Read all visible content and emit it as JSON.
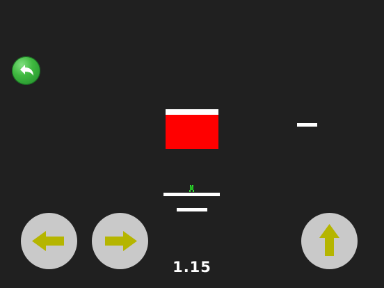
{
  "hud": {
    "timer": "1.15"
  },
  "controls": {
    "back": {
      "icon": "back-arrow-icon"
    },
    "left": {
      "icon": "arrow-left-icon"
    },
    "right": {
      "icon": "arrow-right-icon"
    },
    "jump": {
      "icon": "arrow-up-icon"
    }
  },
  "colors": {
    "background": "#202020",
    "hazard_block": "#ff0000",
    "platform": "#ffffff",
    "control_button": "#c9c9c9",
    "control_arrow": "#b5b500",
    "back_button": "#3fb83f",
    "player": "#33dd33"
  }
}
